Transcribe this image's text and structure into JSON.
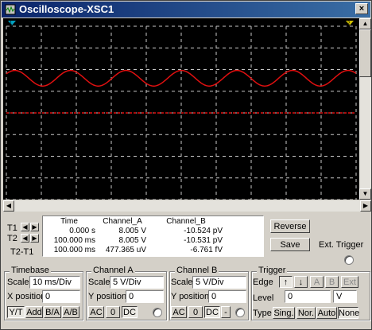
{
  "window": {
    "title": "Oscilloscope-XSC1",
    "close_glyph": "×"
  },
  "readout": {
    "headers": {
      "time": "Time",
      "channel_a": "Channel_A",
      "channel_b": "Channel_B"
    },
    "rows": [
      {
        "label": "T1",
        "time": "0.000 s",
        "a": "8.005 V",
        "b": "-10.524 pV"
      },
      {
        "label": "T2",
        "time": "100.000 ms",
        "a": "8.005 V",
        "b": "-10.531 pV"
      },
      {
        "label": "T2-T1",
        "time": "100.000 ms",
        "a": "477.365 uV",
        "b": "-6.761 fV"
      }
    ]
  },
  "buttons": {
    "reverse": "Reverse",
    "save": "Save",
    "ext_trigger": "Ext. Trigger"
  },
  "timebase": {
    "title": "Timebase",
    "scale_label": "Scale",
    "scale_value": "10 ms/Div",
    "xpos_label": "X position",
    "xpos_value": "0",
    "modes": [
      "Y/T",
      "Add",
      "B/A",
      "A/B"
    ]
  },
  "channel_a": {
    "title": "Channel A",
    "scale_label": "Scale",
    "scale_value": "5  V/Div",
    "ypos_label": "Y position",
    "ypos_value": "0",
    "coupling": [
      "AC",
      "0",
      "DC"
    ]
  },
  "channel_b": {
    "title": "Channel B",
    "scale_label": "Scale",
    "scale_value": "5  V/Div",
    "ypos_label": "Y position",
    "ypos_value": "0",
    "coupling": [
      "AC",
      "0",
      "DC",
      "-"
    ]
  },
  "trigger": {
    "title": "Trigger",
    "edge_label": "Edge",
    "edge_buttons": [
      "↑",
      "↓",
      "A",
      "B",
      "Ext"
    ],
    "level_label": "Level",
    "level_value": "0",
    "level_unit": "V",
    "type_label": "Type",
    "types": [
      "Sing.",
      "Nor.",
      "Auto",
      "None"
    ]
  },
  "colors": {
    "trace_a": "#e01010",
    "trace_b": "#e01010",
    "grid": "#c8c8c8",
    "cursor_t1": "#00a0c0",
    "cursor_t2": "#d0c000"
  }
}
